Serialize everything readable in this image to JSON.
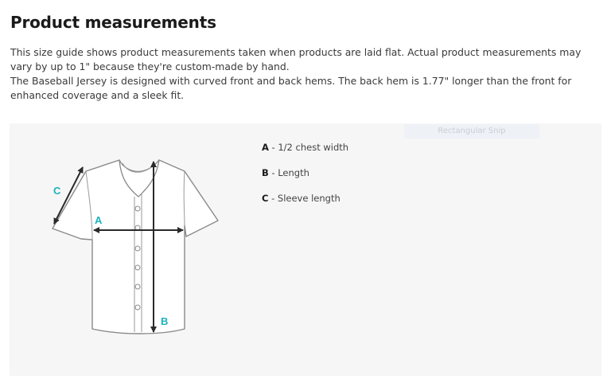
{
  "header": {
    "title": "Product measurements"
  },
  "description": {
    "line1": "This size guide shows product measurements taken when products are laid flat. Actual product measurements may vary by up to 1\" because they're custom-made by hand.",
    "line2": "The Baseball Jersey is designed with curved front and back hems. The back hem is 1.77\" longer than the front for enhanced coverage and a sleek fit."
  },
  "overlay": {
    "label": "Rectangular Snip"
  },
  "diagram": {
    "markers": {
      "a": "A",
      "b": "B",
      "c": "C"
    },
    "accent_color": "#1ab3bc",
    "arrow_color": "#2a2a2a"
  },
  "legend": [
    {
      "key": "A",
      "text": " - 1/2 chest width"
    },
    {
      "key": "B",
      "text": " - Length"
    },
    {
      "key": "C",
      "text": " - Sleeve length"
    }
  ]
}
